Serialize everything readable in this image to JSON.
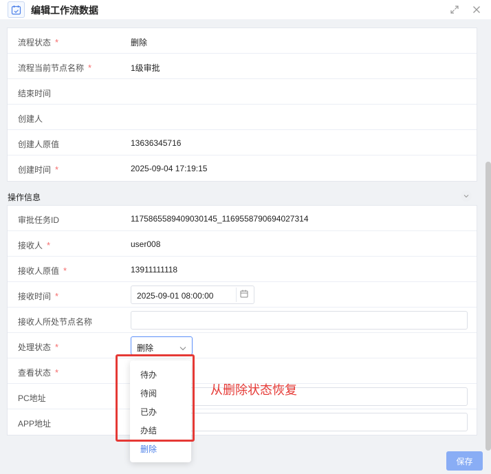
{
  "dialog": {
    "title": "编辑工作流数据"
  },
  "flow_rows": [
    {
      "label": "流程状态",
      "required": true,
      "value": "删除"
    },
    {
      "label": "流程当前节点名称",
      "required": true,
      "value": "1级审批"
    },
    {
      "label": "结束时间",
      "required": false,
      "value": ""
    },
    {
      "label": "创建人",
      "required": false,
      "value": ""
    },
    {
      "label": "创建人原值",
      "required": false,
      "value": "13636345716"
    },
    {
      "label": "创建时间",
      "required": true,
      "value": "2025-09-04 17:19:15"
    }
  ],
  "operation_section": {
    "title": "操作信息",
    "rows": {
      "task_id": {
        "label": "审批任务ID",
        "value": "1175865589409030145_1169558790694027314"
      },
      "receiver": {
        "label": "接收人",
        "value": "user008"
      },
      "receiver_orig": {
        "label": "接收人原值",
        "value": "13911111118"
      },
      "receive_time": {
        "label": "接收时间",
        "value": "2025-09-01 08:00:00"
      },
      "receiver_node": {
        "label": "接收人所处节点名称",
        "value": ""
      },
      "process_status": {
        "label": "处理状态",
        "value": "删除"
      },
      "view_status": {
        "label": "查看状态"
      },
      "pc_url": {
        "label": "PC地址",
        "value": ""
      },
      "app_url": {
        "label": "APP地址",
        "value": ""
      }
    }
  },
  "dropdown_options": [
    {
      "label": "待办",
      "selected": false
    },
    {
      "label": "待阅",
      "selected": false
    },
    {
      "label": "已办",
      "selected": false
    },
    {
      "label": "办结",
      "selected": false
    },
    {
      "label": "删除",
      "selected": true
    }
  ],
  "annotation": "从删除状态恢复",
  "save_label": "保存",
  "colors": {
    "required": "#f56c6c",
    "accent": "#4a7fe8",
    "highlight": "#e53935",
    "save_button": "#89adf5"
  },
  "icons": {
    "header": "calendar-check-icon",
    "expand": "expand-icon",
    "close": "close-icon",
    "collapse": "chevron-down-icon",
    "date": "calendar-icon",
    "select": "chevron-down-icon"
  }
}
